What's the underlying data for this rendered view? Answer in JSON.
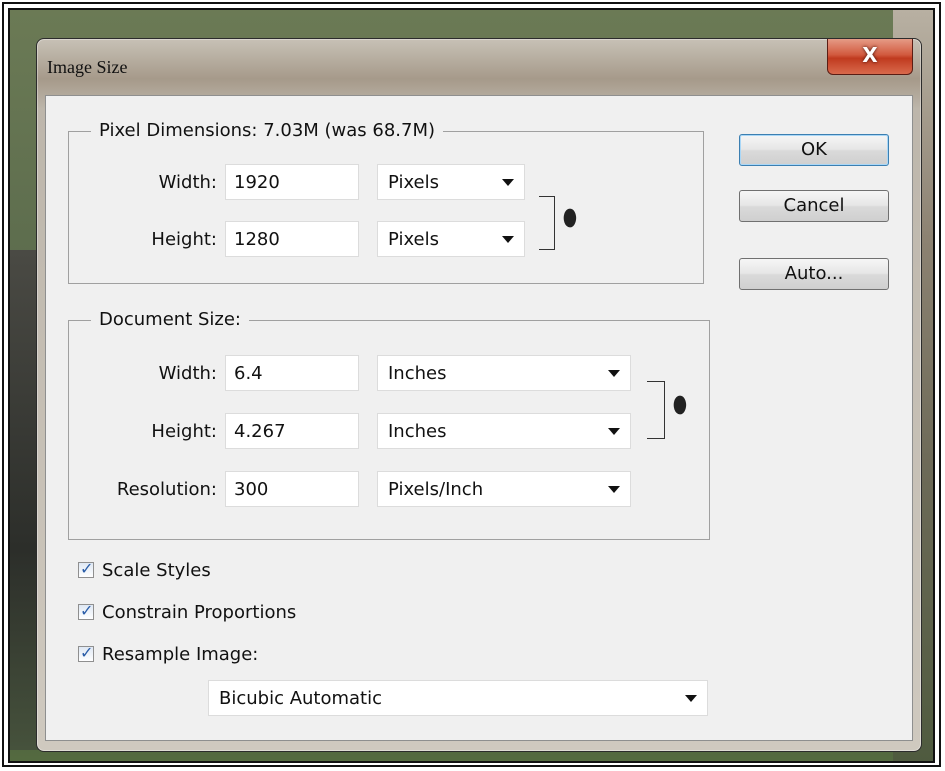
{
  "window": {
    "title": "Image Size",
    "close_glyph": "X"
  },
  "pixel_dimensions": {
    "legend": "Pixel Dimensions:  7.03M (was 68.7M)",
    "width_label": "Width:",
    "width_value": "1920",
    "width_unit": "Pixels",
    "height_label": "Height:",
    "height_value": "1280",
    "height_unit": "Pixels"
  },
  "document_size": {
    "legend": "Document Size:",
    "width_label": "Width:",
    "width_value": "6.4",
    "width_unit": "Inches",
    "height_label": "Height:",
    "height_value": "4.267",
    "height_unit": "Inches",
    "resolution_label": "Resolution:",
    "resolution_value": "300",
    "resolution_unit": "Pixels/Inch"
  },
  "buttons": {
    "ok": "OK",
    "cancel": "Cancel",
    "auto": "Auto..."
  },
  "options": {
    "scale_styles": {
      "label": "Scale Styles",
      "checked": true
    },
    "constrain_proportions": {
      "label": "Constrain Proportions",
      "checked": true
    },
    "resample_image": {
      "label": "Resample Image:",
      "checked": true
    },
    "resample_method": "Bicubic Automatic"
  },
  "icons": {
    "link": "chain-link-icon",
    "dropdown": "chevron-down-icon",
    "check": "checkmark-icon"
  },
  "colors": {
    "ok_border": "#3c7fb1",
    "close_button": "#c03a1f",
    "check_mark": "#2a5da8"
  }
}
